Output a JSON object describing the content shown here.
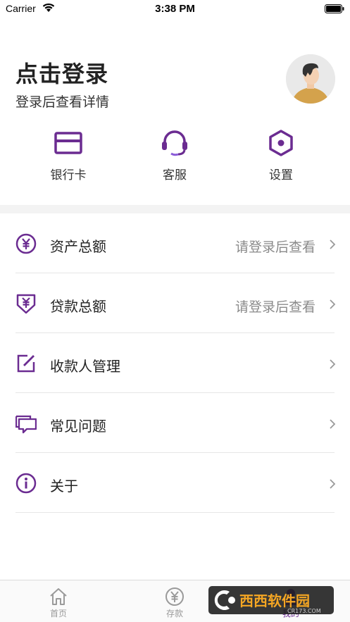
{
  "status_bar": {
    "carrier": "Carrier",
    "time": "3:38 PM"
  },
  "header": {
    "title": "点击登录",
    "subtitle": "登录后查看详情"
  },
  "quick_actions": [
    {
      "label": "银行卡",
      "icon": "bank-card-icon"
    },
    {
      "label": "客服",
      "icon": "headset-icon"
    },
    {
      "label": "设置",
      "icon": "hexagon-settings-icon"
    }
  ],
  "menu": [
    {
      "label": "资产总额",
      "value": "请登录后查看",
      "icon": "yen-circle-icon"
    },
    {
      "label": "贷款总额",
      "value": "请登录后查看",
      "icon": "yen-shield-icon"
    },
    {
      "label": "收款人管理",
      "value": "",
      "icon": "edit-square-icon"
    },
    {
      "label": "常见问题",
      "value": "",
      "icon": "chat-bubbles-icon"
    },
    {
      "label": "关于",
      "value": "",
      "icon": "info-circle-icon"
    }
  ],
  "tab_bar": [
    {
      "label": "首页",
      "icon": "home-icon",
      "active": false
    },
    {
      "label": "存款",
      "icon": "yen-circle-icon",
      "active": false
    },
    {
      "label": "我的",
      "icon": "person-icon",
      "active": true
    }
  ],
  "watermark": {
    "text": "西西软件园",
    "subtext": "CR173.COM"
  },
  "colors": {
    "accent": "#6b2c91",
    "text_primary": "#222222",
    "text_secondary": "#8a8a8a",
    "divider": "#e6e6e6",
    "section_bg": "#f3f3f3"
  }
}
